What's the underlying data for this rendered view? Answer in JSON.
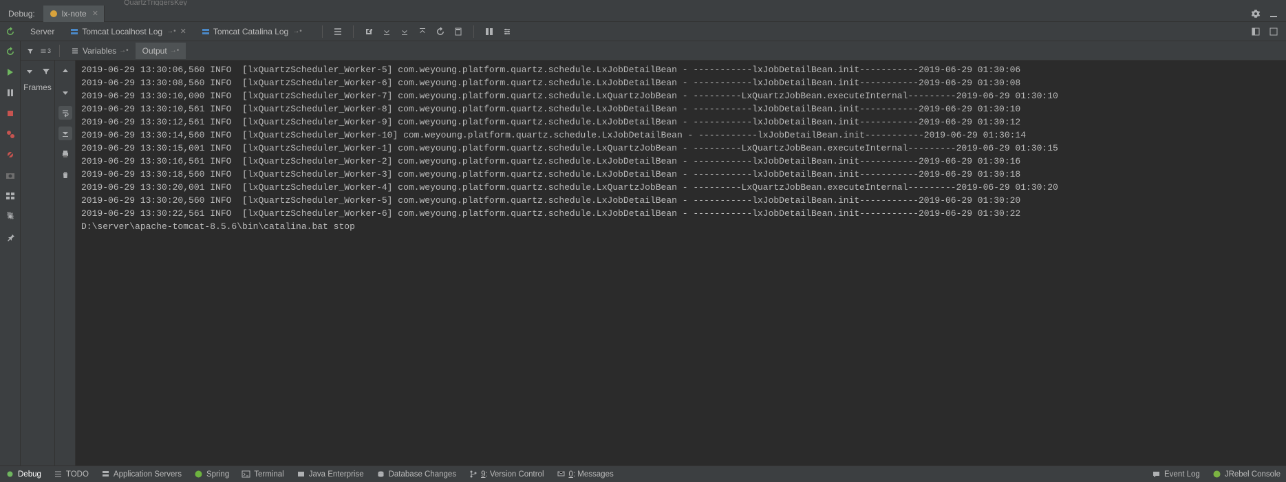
{
  "topStrip": {
    "text": "QuartzTriggersKey"
  },
  "debugRow": {
    "label": "Debug:",
    "tab": {
      "name": "lx-note"
    }
  },
  "serverRow": {
    "label": "Server",
    "logs": [
      {
        "name": "Tomcat Localhost Log"
      },
      {
        "name": "Tomcat Catalina Log"
      }
    ]
  },
  "innerTabs": {
    "variables": "Variables",
    "output": "Output"
  },
  "framesLabel": "Frames",
  "consoleLines": [
    "2019-06-29 13:30:06,560 INFO  [lxQuartzScheduler_Worker-5] com.weyoung.platform.quartz.schedule.LxJobDetailBean - -----------lxJobDetailBean.init-----------2019-06-29 01:30:06",
    "2019-06-29 13:30:08,560 INFO  [lxQuartzScheduler_Worker-6] com.weyoung.platform.quartz.schedule.LxJobDetailBean - -----------lxJobDetailBean.init-----------2019-06-29 01:30:08",
    "2019-06-29 13:30:10,000 INFO  [lxQuartzScheduler_Worker-7] com.weyoung.platform.quartz.schedule.LxQuartzJobBean - ---------LxQuartzJobBean.executeInternal---------2019-06-29 01:30:10",
    "2019-06-29 13:30:10,561 INFO  [lxQuartzScheduler_Worker-8] com.weyoung.platform.quartz.schedule.LxJobDetailBean - -----------lxJobDetailBean.init-----------2019-06-29 01:30:10",
    "2019-06-29 13:30:12,561 INFO  [lxQuartzScheduler_Worker-9] com.weyoung.platform.quartz.schedule.LxJobDetailBean - -----------lxJobDetailBean.init-----------2019-06-29 01:30:12",
    "2019-06-29 13:30:14,560 INFO  [lxQuartzScheduler_Worker-10] com.weyoung.platform.quartz.schedule.LxJobDetailBean - -----------lxJobDetailBean.init-----------2019-06-29 01:30:14",
    "2019-06-29 13:30:15,001 INFO  [lxQuartzScheduler_Worker-1] com.weyoung.platform.quartz.schedule.LxQuartzJobBean - ---------LxQuartzJobBean.executeInternal---------2019-06-29 01:30:15",
    "2019-06-29 13:30:16,561 INFO  [lxQuartzScheduler_Worker-2] com.weyoung.platform.quartz.schedule.LxJobDetailBean - -----------lxJobDetailBean.init-----------2019-06-29 01:30:16",
    "2019-06-29 13:30:18,560 INFO  [lxQuartzScheduler_Worker-3] com.weyoung.platform.quartz.schedule.LxJobDetailBean - -----------lxJobDetailBean.init-----------2019-06-29 01:30:18",
    "2019-06-29 13:30:20,001 INFO  [lxQuartzScheduler_Worker-4] com.weyoung.platform.quartz.schedule.LxQuartzJobBean - ---------LxQuartzJobBean.executeInternal---------2019-06-29 01:30:20",
    "2019-06-29 13:30:20,560 INFO  [lxQuartzScheduler_Worker-5] com.weyoung.platform.quartz.schedule.LxJobDetailBean - -----------lxJobDetailBean.init-----------2019-06-29 01:30:20",
    "2019-06-29 13:30:22,561 INFO  [lxQuartzScheduler_Worker-6] com.weyoung.platform.quartz.schedule.LxJobDetailBean - -----------lxJobDetailBean.init-----------2019-06-29 01:30:22",
    "D:\\server\\apache-tomcat-8.5.6\\bin\\catalina.bat stop"
  ],
  "statusBar": {
    "debug": "Debug",
    "todo": "TODO",
    "appServers": "Application Servers",
    "spring": "Spring",
    "terminal": "Terminal",
    "javaEnterprise": "Java Enterprise",
    "databaseChanges": "Database Changes",
    "versionControl": "9: Version Control",
    "messages": "0: Messages",
    "eventLog": "Event Log",
    "jrebel": "JRebel Console"
  }
}
